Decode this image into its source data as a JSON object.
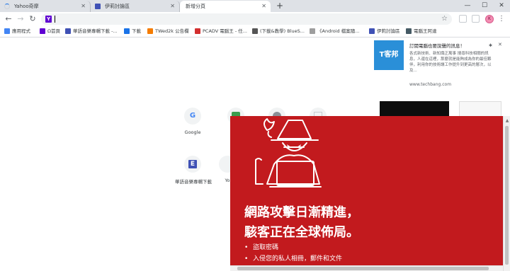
{
  "tabs": [
    {
      "title": "Yahoo奇摩",
      "state": "loading"
    },
    {
      "title": "伊莉討論區",
      "state": "inactive"
    },
    {
      "title": "新增分頁",
      "state": "active"
    }
  ],
  "toolbar": {
    "address_favicon": "Y",
    "address_text": "",
    "avatar_initial": "K"
  },
  "bookmarks": [
    {
      "label": "應用程式",
      "icon": "apps-grid-icon",
      "color": "#4285f4"
    },
    {
      "label": "Ω首頁",
      "icon": "yahoo-icon",
      "color": "#6001d2"
    },
    {
      "label": "華語音樂專輯下載 -...",
      "icon": "e-favicon-icon",
      "color": "#3f51b5"
    },
    {
      "label": "下載",
      "icon": "download-icon",
      "color": "#1a73e8"
    },
    {
      "label": "TWed2k 公告欄",
      "icon": "blogger-icon",
      "color": "#f57c00"
    },
    {
      "label": "PCADV 電腦王 - 任...",
      "icon": "pcadv-icon",
      "color": "#d32f2f"
    },
    {
      "label": "(下載&教學) BlueS...",
      "icon": "page-icon",
      "color": "#555555"
    },
    {
      "label": "《Android 檔案隨...",
      "icon": "page-icon",
      "color": "#9e9e9e"
    },
    {
      "label": "伊莉討論區",
      "icon": "e-favicon-icon",
      "color": "#3f51b5"
    },
    {
      "label": "電腦王阿達",
      "icon": "koc-icon",
      "color": "#455a64"
    }
  ],
  "shortcuts": [
    {
      "label": "Google",
      "glyph": "G",
      "color": "#4285f4"
    },
    {
      "label": "華語音樂專輯下載",
      "glyph": "E",
      "color": "#3f51b5"
    },
    {
      "label": "Yo",
      "glyph": "",
      "color": "#ffffff"
    }
  ],
  "ad": {
    "logo_text": "T客邦",
    "title": "訂閱電腦也要說聲的訊息！",
    "body": "各式新技術、新知識正萬事 搜尋科技相關的訊息，人還在這裡，那麼就是能夠成為你的最佳夥伴，利用你的技術讓工作提升到更高的層次，以及...",
    "url": "www.techbang.com"
  },
  "popup": {
    "headline_1": "網路攻擊日漸精進，",
    "headline_2": "駭客正在全球佈局。",
    "bullets": [
      "盜取密碼",
      "入侵您的私人相冊，郵件和文件"
    ]
  },
  "colors": {
    "popup_red": "#c21a1e",
    "tabstrip": "#dee1e6",
    "accent": "#1a73e8"
  }
}
